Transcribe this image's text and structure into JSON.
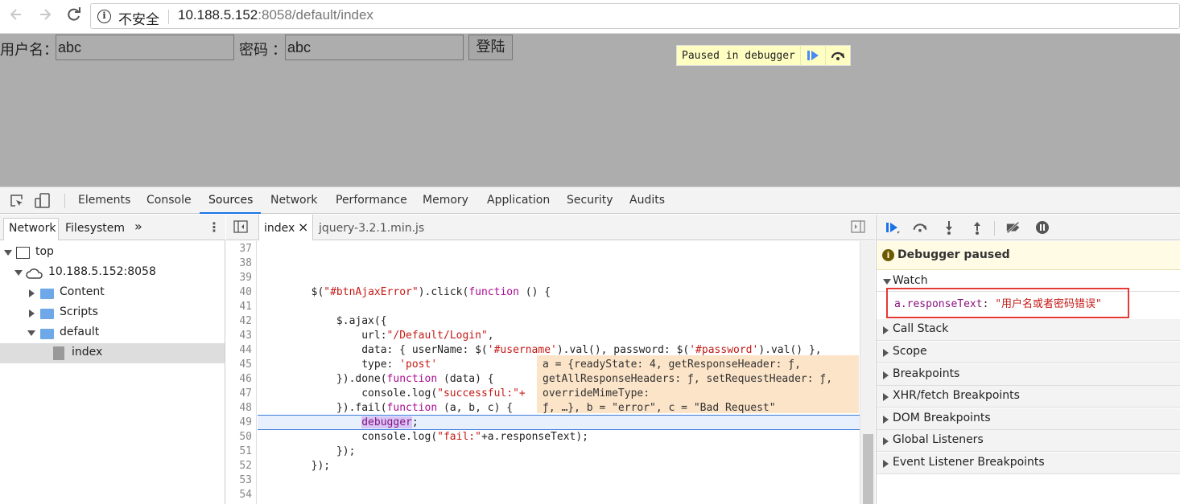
{
  "browser": {
    "security_label": "不安全",
    "url_host": "10.188.5.152",
    "url_rest": ":8058/default/index"
  },
  "page": {
    "username_label": "用户名：",
    "username_value": "abc",
    "password_label": "密码 ：",
    "password_value": "abc",
    "login_label": "登陆",
    "paused_text": "Paused in debugger"
  },
  "devtools": {
    "tabs": [
      "Elements",
      "Console",
      "Sources",
      "Network",
      "Performance",
      "Memory",
      "Application",
      "Security",
      "Audits"
    ],
    "active_tab": "Sources",
    "navigator": {
      "tabs": [
        "Network",
        "Filesystem"
      ],
      "more": "»",
      "tree": [
        "top",
        "10.188.5.152:8058",
        "Content",
        "Scripts",
        "default",
        "index"
      ]
    },
    "editor": {
      "tabs": [
        "index",
        "jquery-3.2.1.min.js"
      ],
      "close": "×",
      "line_numbers": [
        "37",
        "38",
        "39",
        "40",
        "41",
        "42",
        "43",
        "44",
        "45",
        "46",
        "47",
        "48",
        "49",
        "50",
        "51",
        "52",
        "53",
        "54"
      ],
      "code": {
        "l40a": "        $(",
        "l40s": "\"#btnAjaxError\"",
        "l40b": ").click(",
        "l40k": "function",
        "l40c": " () {",
        "l42": "            $.ajax({",
        "l43a": "                url:",
        "l43s": "\"/Default/Login\"",
        "l43b": ",",
        "l44a": "                data: { userName: $(",
        "l44s1": "'#username'",
        "l44b": ").val(), password: $(",
        "l44s2": "'#password'",
        "l44c": ").val() },",
        "l45a": "                type: ",
        "l45s": "'post'",
        "l46a": "            }).done(",
        "l46k": "function",
        "l46b": " (data) {",
        "l47a": "                console.log(",
        "l47s": "\"successful:\"+",
        "l48a": "            }).fail(",
        "l48k": "function",
        "l48b": " (a, b, c) {",
        "l49k": "debugger",
        "l49b": ";",
        "l50a": "                console.log(",
        "l50s": "\"fail:\"",
        "l50b": "+a.responseText);",
        "l51": "            });",
        "l52": "        });"
      },
      "popover_lines": [
        "a = {readyState: 4, getResponseHeader: ƒ,",
        "getAllResponseHeaders: ƒ, setRequestHeader: ƒ,",
        "overrideMimeType:",
        "ƒ, …}, b = \"error\", c = \"Bad Request\""
      ]
    },
    "sidebar": {
      "paused_message": "Debugger paused",
      "watch_title": "Watch",
      "watch_key": "a.responseText",
      "watch_sep": ": ",
      "watch_value": "\"用户名或者密码错误\"",
      "panes": [
        "Call Stack",
        "Scope",
        "Breakpoints",
        "XHR/fetch Breakpoints",
        "DOM Breakpoints",
        "Global Listeners",
        "Event Listener Breakpoints"
      ]
    }
  },
  "colors": {
    "accent": "#1a73e8",
    "string": "#c41a16",
    "keyword": "#aa0d91",
    "watch_highlight": "#e53935"
  }
}
